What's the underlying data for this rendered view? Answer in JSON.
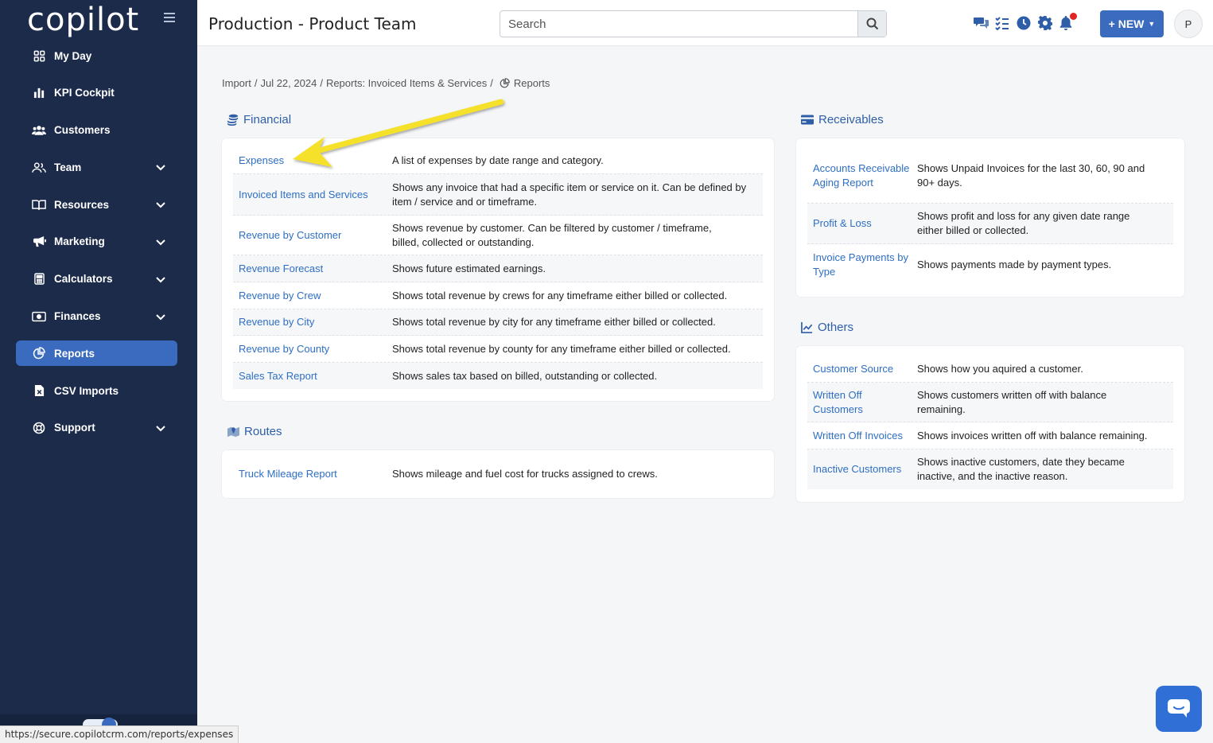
{
  "app": {
    "logo": "copilot"
  },
  "sidebar": {
    "items": [
      {
        "label": "My Day",
        "icon": "grid-icon",
        "has_chevron": false
      },
      {
        "label": "KPI Cockpit",
        "icon": "bar-chart-icon",
        "has_chevron": false
      },
      {
        "label": "Customers",
        "icon": "users-icon",
        "has_chevron": false
      },
      {
        "label": "Team",
        "icon": "team-icon",
        "has_chevron": true
      },
      {
        "label": "Resources",
        "icon": "book-icon",
        "has_chevron": true
      },
      {
        "label": "Marketing",
        "icon": "megaphone-icon",
        "has_chevron": true
      },
      {
        "label": "Calculators",
        "icon": "calculator-icon",
        "has_chevron": true
      },
      {
        "label": "Finances",
        "icon": "money-icon",
        "has_chevron": true
      },
      {
        "label": "Reports",
        "icon": "pie-chart-icon",
        "has_chevron": false,
        "active": true
      },
      {
        "label": "CSV Imports",
        "icon": "csv-file-icon",
        "has_chevron": false
      },
      {
        "label": "Support",
        "icon": "lifebuoy-icon",
        "has_chevron": true
      }
    ]
  },
  "header": {
    "title": "Production - Product Team",
    "search_placeholder": "Search",
    "new_label": "+ NEW",
    "avatar_initial": "P"
  },
  "breadcrumb": {
    "items": [
      "Import",
      "Jul 22, 2024",
      "Reports: Invoiced Items & Services"
    ],
    "current": "Reports"
  },
  "sections": {
    "financial": {
      "title": "Financial",
      "rows": [
        {
          "name": "Expenses",
          "desc": "A list of expenses by date range and category."
        },
        {
          "name": "Invoiced Items and Services",
          "desc": "Shows any invoice that had a specific item or service on it. Can be defined by item / service and or timeframe."
        },
        {
          "name": "Revenue by Customer",
          "desc": "Shows revenue by customer. Can be filtered by customer / timeframe, billed, collected or outstanding."
        },
        {
          "name": "Revenue Forecast",
          "desc": "Shows future estimated earnings."
        },
        {
          "name": "Revenue by Crew",
          "desc": "Shows total revenue by crews for any timeframe either billed or collected."
        },
        {
          "name": "Revenue by City",
          "desc": "Shows total revenue by city for any timeframe either billed or collected."
        },
        {
          "name": "Revenue by County",
          "desc": "Shows total revenue by county for any timeframe either billed or collected."
        },
        {
          "name": "Sales Tax Report",
          "desc": "Shows sales tax based on billed, outstanding or collected."
        }
      ]
    },
    "routes": {
      "title": "Routes",
      "rows": [
        {
          "name": "Truck Mileage Report",
          "desc": "Shows mileage and fuel cost for trucks assigned to crews."
        }
      ]
    },
    "receivables": {
      "title": "Receivables",
      "rows": [
        {
          "name": "Accounts Receivable Aging Report",
          "desc": "Shows Unpaid Invoices for the last 30, 60, 90 and 90+ days."
        },
        {
          "name": "Profit & Loss",
          "desc": "Shows profit and loss for any given date range either billed or collected."
        },
        {
          "name": "Invoice Payments by Type",
          "desc": "Shows payments made by payment types."
        }
      ]
    },
    "others": {
      "title": "Others",
      "rows": [
        {
          "name": "Customer Source",
          "desc": "Shows how you aquired a customer."
        },
        {
          "name": "Written Off Customers",
          "desc": "Shows customers written off with balance remaining."
        },
        {
          "name": "Written Off Invoices",
          "desc": "Shows invoices written off with balance remaining."
        },
        {
          "name": "Inactive Customers",
          "desc": "Shows inactive customers, date they became inactive, and the inactive reason."
        }
      ]
    }
  },
  "status_bar": {
    "url": "https://secure.copilotcrm.com/reports/expenses"
  },
  "colors": {
    "sidebar_bg": "#1c2b4a",
    "accent": "#3b6bbf",
    "link": "#2e6fc4",
    "annotation_arrow": "#f5e02a"
  }
}
